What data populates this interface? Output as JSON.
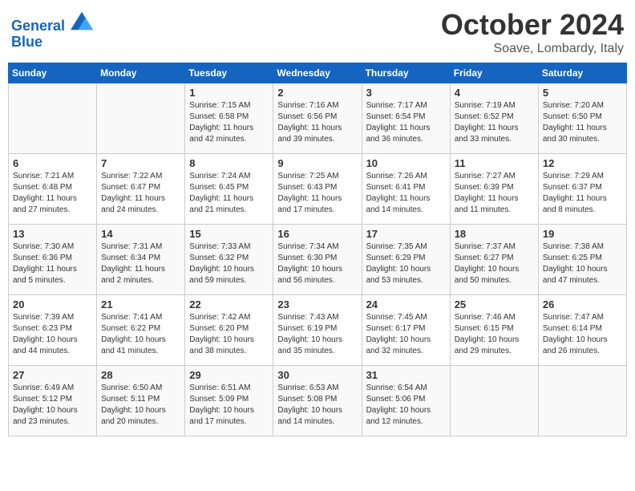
{
  "header": {
    "logo_line1": "General",
    "logo_line2": "Blue",
    "month_title": "October 2024",
    "location": "Soave, Lombardy, Italy"
  },
  "days_of_week": [
    "Sunday",
    "Monday",
    "Tuesday",
    "Wednesday",
    "Thursday",
    "Friday",
    "Saturday"
  ],
  "weeks": [
    [
      {
        "day": "",
        "sunrise": "",
        "sunset": "",
        "daylight": ""
      },
      {
        "day": "",
        "sunrise": "",
        "sunset": "",
        "daylight": ""
      },
      {
        "day": "1",
        "sunrise": "Sunrise: 7:15 AM",
        "sunset": "Sunset: 6:58 PM",
        "daylight": "Daylight: 11 hours and 42 minutes."
      },
      {
        "day": "2",
        "sunrise": "Sunrise: 7:16 AM",
        "sunset": "Sunset: 6:56 PM",
        "daylight": "Daylight: 11 hours and 39 minutes."
      },
      {
        "day": "3",
        "sunrise": "Sunrise: 7:17 AM",
        "sunset": "Sunset: 6:54 PM",
        "daylight": "Daylight: 11 hours and 36 minutes."
      },
      {
        "day": "4",
        "sunrise": "Sunrise: 7:19 AM",
        "sunset": "Sunset: 6:52 PM",
        "daylight": "Daylight: 11 hours and 33 minutes."
      },
      {
        "day": "5",
        "sunrise": "Sunrise: 7:20 AM",
        "sunset": "Sunset: 6:50 PM",
        "daylight": "Daylight: 11 hours and 30 minutes."
      }
    ],
    [
      {
        "day": "6",
        "sunrise": "Sunrise: 7:21 AM",
        "sunset": "Sunset: 6:48 PM",
        "daylight": "Daylight: 11 hours and 27 minutes."
      },
      {
        "day": "7",
        "sunrise": "Sunrise: 7:22 AM",
        "sunset": "Sunset: 6:47 PM",
        "daylight": "Daylight: 11 hours and 24 minutes."
      },
      {
        "day": "8",
        "sunrise": "Sunrise: 7:24 AM",
        "sunset": "Sunset: 6:45 PM",
        "daylight": "Daylight: 11 hours and 21 minutes."
      },
      {
        "day": "9",
        "sunrise": "Sunrise: 7:25 AM",
        "sunset": "Sunset: 6:43 PM",
        "daylight": "Daylight: 11 hours and 17 minutes."
      },
      {
        "day": "10",
        "sunrise": "Sunrise: 7:26 AM",
        "sunset": "Sunset: 6:41 PM",
        "daylight": "Daylight: 11 hours and 14 minutes."
      },
      {
        "day": "11",
        "sunrise": "Sunrise: 7:27 AM",
        "sunset": "Sunset: 6:39 PM",
        "daylight": "Daylight: 11 hours and 11 minutes."
      },
      {
        "day": "12",
        "sunrise": "Sunrise: 7:29 AM",
        "sunset": "Sunset: 6:37 PM",
        "daylight": "Daylight: 11 hours and 8 minutes."
      }
    ],
    [
      {
        "day": "13",
        "sunrise": "Sunrise: 7:30 AM",
        "sunset": "Sunset: 6:36 PM",
        "daylight": "Daylight: 11 hours and 5 minutes."
      },
      {
        "day": "14",
        "sunrise": "Sunrise: 7:31 AM",
        "sunset": "Sunset: 6:34 PM",
        "daylight": "Daylight: 11 hours and 2 minutes."
      },
      {
        "day": "15",
        "sunrise": "Sunrise: 7:33 AM",
        "sunset": "Sunset: 6:32 PM",
        "daylight": "Daylight: 10 hours and 59 minutes."
      },
      {
        "day": "16",
        "sunrise": "Sunrise: 7:34 AM",
        "sunset": "Sunset: 6:30 PM",
        "daylight": "Daylight: 10 hours and 56 minutes."
      },
      {
        "day": "17",
        "sunrise": "Sunrise: 7:35 AM",
        "sunset": "Sunset: 6:29 PM",
        "daylight": "Daylight: 10 hours and 53 minutes."
      },
      {
        "day": "18",
        "sunrise": "Sunrise: 7:37 AM",
        "sunset": "Sunset: 6:27 PM",
        "daylight": "Daylight: 10 hours and 50 minutes."
      },
      {
        "day": "19",
        "sunrise": "Sunrise: 7:38 AM",
        "sunset": "Sunset: 6:25 PM",
        "daylight": "Daylight: 10 hours and 47 minutes."
      }
    ],
    [
      {
        "day": "20",
        "sunrise": "Sunrise: 7:39 AM",
        "sunset": "Sunset: 6:23 PM",
        "daylight": "Daylight: 10 hours and 44 minutes."
      },
      {
        "day": "21",
        "sunrise": "Sunrise: 7:41 AM",
        "sunset": "Sunset: 6:22 PM",
        "daylight": "Daylight: 10 hours and 41 minutes."
      },
      {
        "day": "22",
        "sunrise": "Sunrise: 7:42 AM",
        "sunset": "Sunset: 6:20 PM",
        "daylight": "Daylight: 10 hours and 38 minutes."
      },
      {
        "day": "23",
        "sunrise": "Sunrise: 7:43 AM",
        "sunset": "Sunset: 6:19 PM",
        "daylight": "Daylight: 10 hours and 35 minutes."
      },
      {
        "day": "24",
        "sunrise": "Sunrise: 7:45 AM",
        "sunset": "Sunset: 6:17 PM",
        "daylight": "Daylight: 10 hours and 32 minutes."
      },
      {
        "day": "25",
        "sunrise": "Sunrise: 7:46 AM",
        "sunset": "Sunset: 6:15 PM",
        "daylight": "Daylight: 10 hours and 29 minutes."
      },
      {
        "day": "26",
        "sunrise": "Sunrise: 7:47 AM",
        "sunset": "Sunset: 6:14 PM",
        "daylight": "Daylight: 10 hours and 26 minutes."
      }
    ],
    [
      {
        "day": "27",
        "sunrise": "Sunrise: 6:49 AM",
        "sunset": "Sunset: 5:12 PM",
        "daylight": "Daylight: 10 hours and 23 minutes."
      },
      {
        "day": "28",
        "sunrise": "Sunrise: 6:50 AM",
        "sunset": "Sunset: 5:11 PM",
        "daylight": "Daylight: 10 hours and 20 minutes."
      },
      {
        "day": "29",
        "sunrise": "Sunrise: 6:51 AM",
        "sunset": "Sunset: 5:09 PM",
        "daylight": "Daylight: 10 hours and 17 minutes."
      },
      {
        "day": "30",
        "sunrise": "Sunrise: 6:53 AM",
        "sunset": "Sunset: 5:08 PM",
        "daylight": "Daylight: 10 hours and 14 minutes."
      },
      {
        "day": "31",
        "sunrise": "Sunrise: 6:54 AM",
        "sunset": "Sunset: 5:06 PM",
        "daylight": "Daylight: 10 hours and 12 minutes."
      },
      {
        "day": "",
        "sunrise": "",
        "sunset": "",
        "daylight": ""
      },
      {
        "day": "",
        "sunrise": "",
        "sunset": "",
        "daylight": ""
      }
    ]
  ]
}
